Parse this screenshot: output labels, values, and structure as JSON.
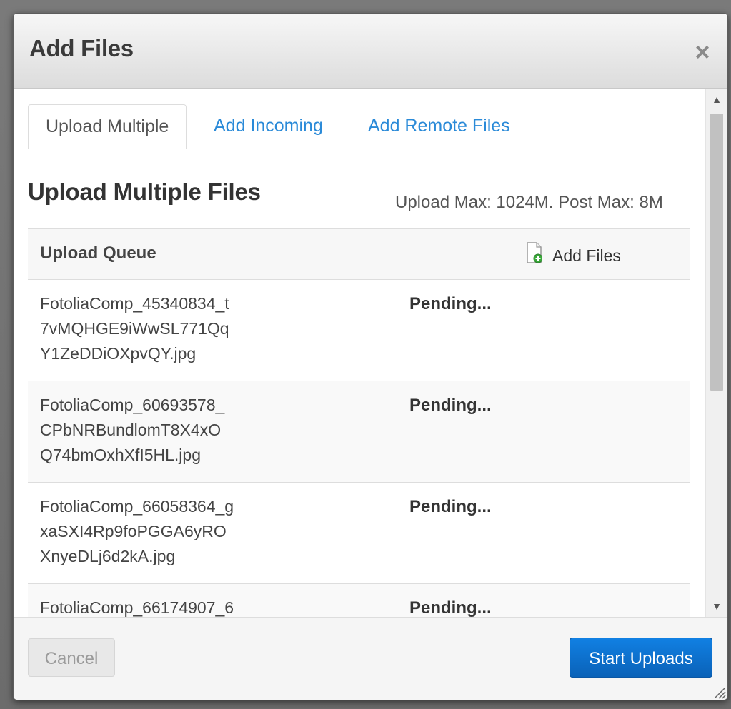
{
  "dialog": {
    "title": "Add Files",
    "close_glyph": "×"
  },
  "tabs": [
    {
      "label": "Upload Multiple",
      "active": true
    },
    {
      "label": "Add Incoming",
      "active": false
    },
    {
      "label": "Add Remote Files",
      "active": false
    }
  ],
  "section": {
    "title": "Upload Multiple Files",
    "limits": "Upload Max: 1024M. Post Max: 8M"
  },
  "queue": {
    "header": "Upload Queue",
    "add_files_label": "Add Files",
    "add_files_icon": "file-add-icon",
    "rows": [
      {
        "filename": "FotoliaComp_45340834_t\n7vMQHGE9iWwSL771Qq\nY1ZeDDiOXpvQY.jpg",
        "status": "Pending..."
      },
      {
        "filename": "FotoliaComp_60693578_\nCPbNRBundlomT8X4xO\nQ74bmOxhXfI5HL.jpg",
        "status": "Pending..."
      },
      {
        "filename": "FotoliaComp_66058364_g\nxaSXI4Rp9foPGGA6yRO\nXnyeDLj6d2kA.jpg",
        "status": "Pending..."
      },
      {
        "filename": "FotoliaComp_66174907_6",
        "status": "Pending..."
      }
    ]
  },
  "footer": {
    "cancel_label": "Cancel",
    "start_label": "Start Uploads"
  },
  "colors": {
    "accent": "#2a8ad8",
    "primary_button": "#0a6fd0",
    "disabled_text": "#9a9a9a"
  }
}
